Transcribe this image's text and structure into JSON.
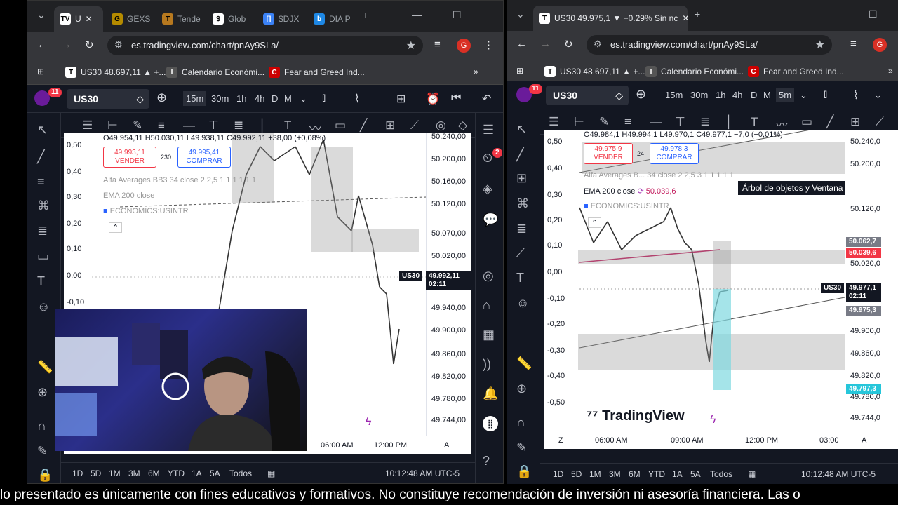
{
  "left": {
    "tabs": [
      {
        "label": "U",
        "favicon": "TV"
      },
      {
        "label": "GEXS",
        "favicon": "G"
      },
      {
        "label": "Tende",
        "favicon": "T"
      },
      {
        "label": "Glob",
        "favicon": "$"
      },
      {
        "label": "$DJX",
        "favicon": "[]"
      },
      {
        "label": "DIA P",
        "favicon": "b"
      }
    ],
    "url": "es.tradingview.com/chart/pnAy9SLa/",
    "bookmarks": [
      "US30 48.697,11 ▲ +...",
      "Calendario Económi...",
      "Fear and Greed Ind..."
    ],
    "symbol": "US30",
    "alerts_badge": "11",
    "intervals": [
      "15m",
      "30m",
      "1h",
      "4h",
      "D",
      "M"
    ],
    "active_interval": "15m",
    "ohlc": "O49.954,11 H50.030,11 L49.938,11 C49.992,11 +38,00 (+0,08%)",
    "sell_price": "49.993,11",
    "sell_label": "VENDER",
    "spread": "230",
    "buy_price": "49.995,41",
    "buy_label": "COMPRAR",
    "indicators": [
      "Alfa Averages BB3 34 close 2 2,5 1 1 1 1 1 1",
      "EMA 200 close",
      "ECONOMICS:USINTR"
    ],
    "pct_axis": [
      "0,50",
      "0,40",
      "0,30",
      "0,20",
      "0,10",
      "0,00",
      "-0,10"
    ],
    "price_axis": [
      "50.240,00",
      "50.200,00",
      "50.160,00",
      "50.120,00",
      "50.070,00",
      "50.020,00",
      "49.940,00",
      "49.900,00",
      "49.860,00",
      "49.820,00",
      "49.780,00",
      "49.744,00"
    ],
    "last_tag": "US30",
    "last_price": "49.992,11",
    "last_time": "02:11",
    "time_axis": [
      "06:00 AM",
      "12:00 PM"
    ],
    "range_buttons": [
      "1D",
      "5D",
      "1M",
      "3M",
      "6M",
      "YTD",
      "1A",
      "5A",
      "Todos"
    ],
    "clock": "10:12:48 AM UTC-5",
    "notif_badge": "2",
    "axis_mode": "A"
  },
  "right": {
    "tab_label": "US30 49.975,1 ▼ −0.29% Sin nc",
    "url": "es.tradingview.com/chart/pnAy9SLa/",
    "bookmarks": [
      "US30 48.697,11 ▲ +...",
      "Calendario Económi...",
      "Fear and Greed Ind..."
    ],
    "symbol": "US30",
    "alerts_badge": "11",
    "intervals": [
      "15m",
      "30m",
      "1h",
      "4h",
      "D",
      "M",
      "5m"
    ],
    "active_interval": "5m",
    "ohlc": "O49.984,1 H49.994,1 L49.970,1 C49.977,1 −7,0 (−0,01%)",
    "sell_price": "49.975,9",
    "sell_label": "VENDER",
    "spread": "24",
    "buy_price": "49.978,3",
    "buy_label": "COMPRAR",
    "indicators": [
      "Alfa Averages B... 34 close 2 2,5 3 1 1 1 1 1",
      "EMA 200 close",
      "ECONOMICS:USINTR"
    ],
    "ema_value": "50.039,6",
    "tooltip": "Árbol de objetos y Ventana de datos",
    "pct_axis": [
      "0,50",
      "0,40",
      "0,30",
      "0,20",
      "0,10",
      "0,00",
      "-0,10",
      "-0,20",
      "-0,30",
      "-0,40",
      "-0,50"
    ],
    "price_axis": [
      "50.240,0",
      "50.200,0",
      "50.120,0",
      "50.020,0",
      "49.900,0",
      "49.860,0",
      "49.820,0",
      "49.780,0",
      "49.744,0"
    ],
    "tag_red1": "50.062,7",
    "tag_red2": "50.039,6",
    "last_tag": "US30",
    "last_price": "49.977,1",
    "last_time": "02:11",
    "tag_gray": "49.975,3",
    "tag_teal": "49.797,3",
    "time_axis": [
      "06:00 AM",
      "09:00 AM",
      "12:00 PM",
      "03:00"
    ],
    "watermark": "TradingView",
    "range_buttons": [
      "1D",
      "5D",
      "1M",
      "3M",
      "6M",
      "YTD",
      "1A",
      "5A",
      "Todos"
    ],
    "clock": "10:12:48 AM UTC-5",
    "axis_mode": "A",
    "zoom_label": "Z"
  },
  "subtitle": "lo presentado es únicamente con fines educativos y formativos. No constituye recomendación de inversión ni asesoría financiera. Las o",
  "colors": {
    "sell": "#f23645",
    "buy": "#2962ff",
    "ema": "#c2185b",
    "teal": "#7fd8e0",
    "tv_bg": "#131722"
  }
}
